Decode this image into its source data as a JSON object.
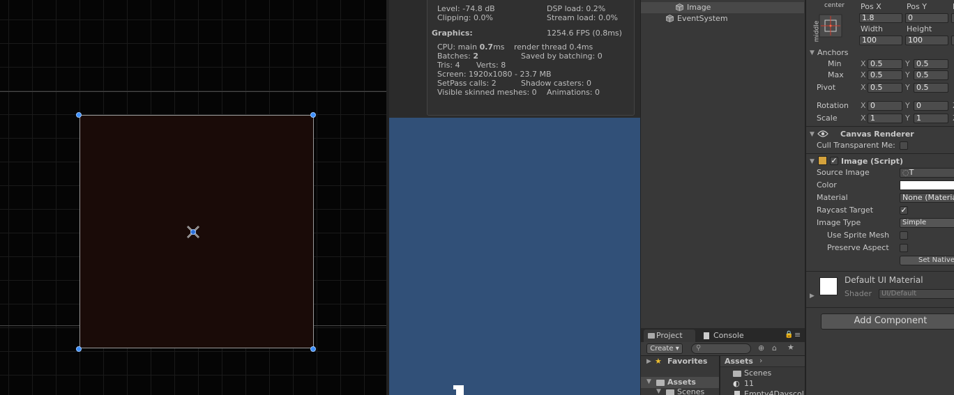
{
  "stats": {
    "level": "Level: -74.8 dB",
    "clipping": "Clipping: 0.0%",
    "dsp_load": "DSP load: 0.2%",
    "stream_load": "Stream load: 0.0%",
    "graphics_label": "Graphics:",
    "fps": "1254.6 FPS (0.8ms)",
    "cpu_main_prefix": "CPU: main ",
    "cpu_main_value": "0.7",
    "cpu_main_suffix": "ms",
    "render_thread": "render thread 0.4ms",
    "batches_prefix": "Batches: ",
    "batches_value": "2",
    "saved_by_batching": "Saved by batching: 0",
    "tris": "Tris: 4",
    "verts": "Verts: 8",
    "screen": "Screen: 1920x1080 - 23.7 MB",
    "setpass": "SetPass calls: 2",
    "shadow_casters": "Shadow casters: 0",
    "skinned_meshes": "Visible skinned meshes: 0",
    "animations": "Animations: 0"
  },
  "game": {
    "glyph": "T"
  },
  "hierarchy": {
    "items": [
      {
        "label": "Image"
      },
      {
        "label": "EventSystem"
      }
    ]
  },
  "project": {
    "tabs": [
      "Project",
      "Console"
    ],
    "create_label": "Create",
    "favorites_label": "Favorites",
    "assets_label": "Assets",
    "tree_scenes": "Scenes",
    "breadcrumb": "Assets",
    "files": [
      "Scenes",
      "11",
      "Empty4Dayscol"
    ]
  },
  "inspector": {
    "anchor_preset_h": "center",
    "anchor_preset_v": "middle",
    "pos_x_label": "Pos X",
    "pos_y_label": "Pos Y",
    "pos_x": "1.8",
    "pos_y": "0",
    "width_label": "Width",
    "height_label": "Height",
    "width": "100",
    "height": "100",
    "anchors_label": "Anchors",
    "min_label": "Min",
    "max_label": "Max",
    "x_axis": "X",
    "y_axis": "Y",
    "z_axis": "Z",
    "anchor_min_x": "0.5",
    "anchor_min_y": "0.5",
    "anchor_max_x": "0.5",
    "anchor_max_y": "0.5",
    "pivot_label": "Pivot",
    "pivot_x": "0.5",
    "pivot_y": "0.5",
    "rotation_label": "Rotation",
    "rotation_x": "0",
    "rotation_y": "0",
    "scale_label": "Scale",
    "scale_x": "1",
    "scale_y": "1",
    "canvas_renderer_title": "Canvas Renderer",
    "cull_transparent_label": "Cull Transparent Me:",
    "image_script_title": "Image (Script)",
    "source_image_label": "Source Image",
    "source_image_value": "T",
    "color_label": "Color",
    "material_label": "Material",
    "material_value": "None (Materia",
    "raycast_target_label": "Raycast Target",
    "image_type_label": "Image Type",
    "image_type_value": "Simple",
    "use_sprite_mesh_label": "Use Sprite Mesh",
    "preserve_aspect_label": "Preserve Aspect",
    "set_native_label": "Set Native",
    "default_ui_material": "Default UI Material",
    "shader_label": "Shader",
    "shader_value": "UI/Default",
    "add_component_label": "Add Component"
  },
  "colors": {
    "selection_handle": "#3c8fff",
    "game_background": "#315078",
    "rect_fill": "#1a0b08"
  }
}
